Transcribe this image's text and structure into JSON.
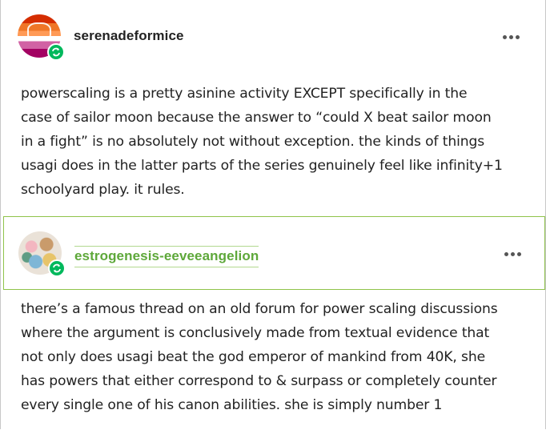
{
  "posts": [
    {
      "username": "serenadeformice",
      "avatar_icon": "lesbian-flag-avatar",
      "badge_icon": "reblog-icon",
      "more_icon": "more-options-icon",
      "text": "powerscaling is a pretty asinine activity EXCEPT specifically in the\ncase of sailor moon because the answer to “could X beat sailor moon\nin a fight” is no absolutely not without exception. the kinds of things\nusagi does in the latter parts of the series genuinely feel like infinity+1\nschoolyard play. it rules."
    },
    {
      "username": "estrogenesis-eeveeangelion",
      "avatar_icon": "eevee-avatar",
      "badge_icon": "reblog-icon",
      "more_icon": "more-options-icon",
      "text": "there’s a famous thread on an old forum for power scaling discussions\nwhere the argument is conclusively made from textual evidence that\nnot only does usagi beat the god emperor of mankind from 40K, she\nhas powers that either correspond to & surpass or completely counter\nevery single one of his canon abilities. she is simply number 1"
    }
  ],
  "colors": {
    "reblog_badge": "#00b85c",
    "highlight_border": "#8fc34a",
    "highlight_username": "#5ea83a",
    "text": "#222222"
  }
}
